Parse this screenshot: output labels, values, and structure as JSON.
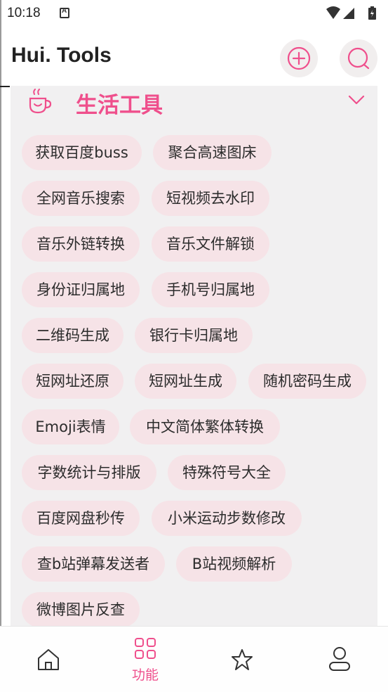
{
  "status_bar": {
    "time": "10:18",
    "notification_icon": "a-box-icon"
  },
  "header": {
    "title": "Hui. Tools",
    "add_icon": "plus-circle-icon",
    "search_icon": "search-icon"
  },
  "section": {
    "title": "生活工具",
    "icon": "cup-icon",
    "expand_icon": "chevron-down-icon"
  },
  "tools": [
    "获取百度buss",
    "聚合高速图床",
    "全网音乐搜索",
    "短视频去水印",
    "音乐外链转换",
    "音乐文件解锁",
    "身份证归属地",
    "手机号归属地",
    "二维码生成",
    "银行卡归属地",
    "短网址还原",
    "短网址生成",
    "随机密码生成",
    "Emoji表情",
    "中文简体繁体转换",
    "字数统计与排版",
    "特殊符号大全",
    "百度网盘秒传",
    "小米运动步数修改",
    "查b站弹幕发送者",
    "B站视频解析",
    "微博图片反查"
  ],
  "nav": {
    "active_label": "功能",
    "items": [
      "home-icon",
      "grid-icon",
      "star-icon",
      "user-icon"
    ]
  },
  "colors": {
    "accent": "#ef4f8c",
    "chip_bg": "#f6e3e7",
    "card_bg": "#f1f0f1"
  }
}
